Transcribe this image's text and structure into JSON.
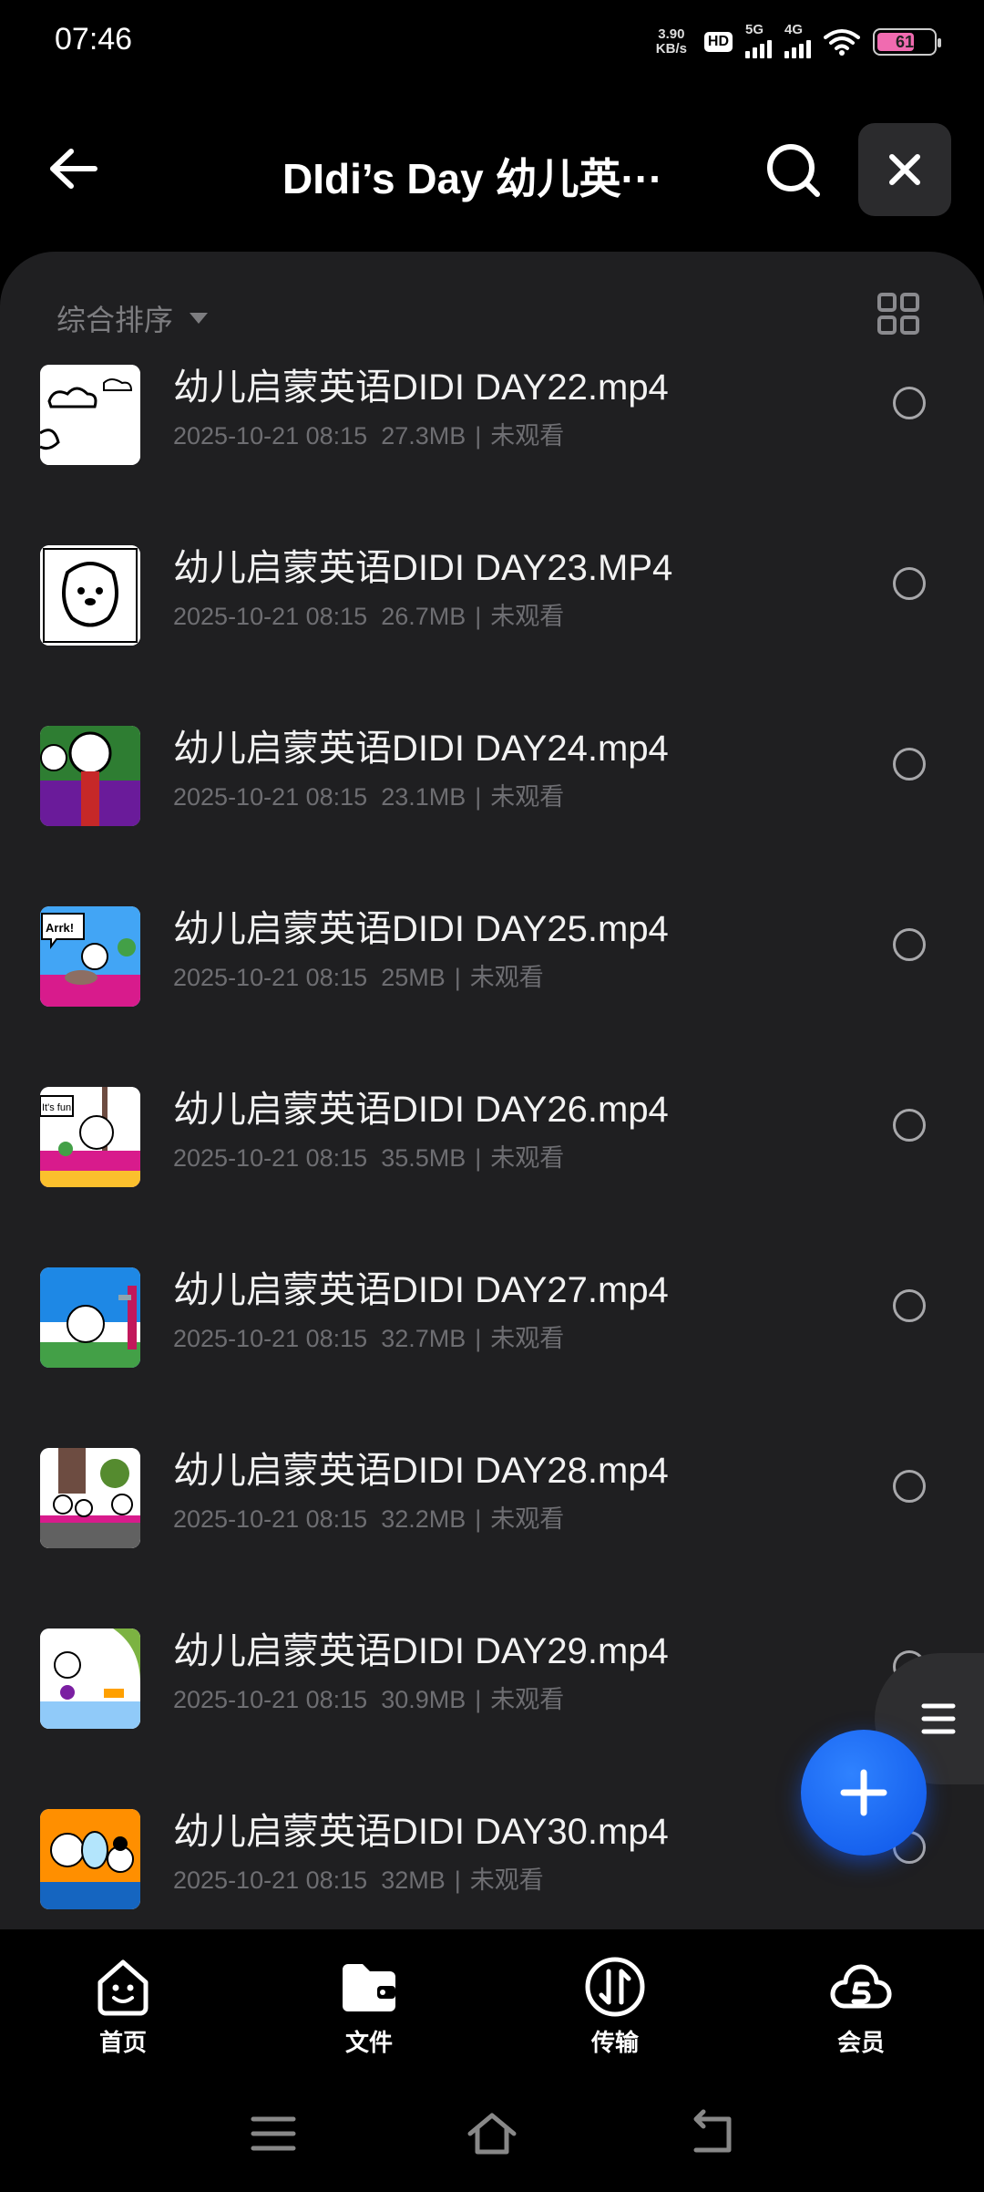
{
  "status_bar": {
    "time": "07:46",
    "net_speed_value": "3.90",
    "net_speed_unit": "KB/s",
    "hd_label": "HD",
    "sim1_label": "5G",
    "sim2_label": "4G",
    "battery_level": "61"
  },
  "header": {
    "title": "DIdi’s Day 幼儿英···"
  },
  "toolbar": {
    "sort_label": "综合排序"
  },
  "files": [
    {
      "name": "幼儿启蒙英语DIDI DAY22.mp4",
      "date": "2025-10-21 08:15",
      "size": "27.3MB",
      "status": "未观看"
    },
    {
      "name": "幼儿启蒙英语DIDI DAY23.MP4",
      "date": "2025-10-21 08:15",
      "size": "26.7MB",
      "status": "未观看"
    },
    {
      "name": "幼儿启蒙英语DIDI DAY24.mp4",
      "date": "2025-10-21 08:15",
      "size": "23.1MB",
      "status": "未观看"
    },
    {
      "name": "幼儿启蒙英语DIDI DAY25.mp4",
      "date": "2025-10-21 08:15",
      "size": "25MB",
      "status": "未观看"
    },
    {
      "name": "幼儿启蒙英语DIDI DAY26.mp4",
      "date": "2025-10-21 08:15",
      "size": "35.5MB",
      "status": "未观看"
    },
    {
      "name": "幼儿启蒙英语DIDI DAY27.mp4",
      "date": "2025-10-21 08:15",
      "size": "32.7MB",
      "status": "未观看"
    },
    {
      "name": "幼儿启蒙英语DIDI DAY28.mp4",
      "date": "2025-10-21 08:15",
      "size": "32.2MB",
      "status": "未观看"
    },
    {
      "name": "幼儿启蒙英语DIDI DAY29.mp4",
      "date": "2025-10-21 08:15",
      "size": "30.9MB",
      "status": "未观看"
    },
    {
      "name": "幼儿启蒙英语DIDI DAY30.mp4",
      "date": "2025-10-21 08:15",
      "size": "32MB",
      "status": "未观看"
    }
  ],
  "thumb_text": {
    "day25": "Arrk!",
    "day26": "It's fun!"
  },
  "bottom_nav": [
    {
      "label": "首页",
      "icon": "home-face-icon"
    },
    {
      "label": "文件",
      "icon": "folder-icon"
    },
    {
      "label": "传输",
      "icon": "transfer-icon"
    },
    {
      "label": "会员",
      "icon": "vip-cloud-icon"
    }
  ],
  "colors": {
    "panel_bg": "#1f1f21",
    "fab_blue": "#1a66ff",
    "meta_gray": "#6e6e72"
  }
}
